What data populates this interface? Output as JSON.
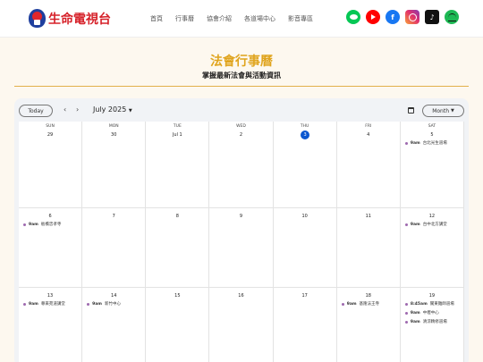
{
  "brand": {
    "name": "生命電視台"
  },
  "nav": [
    "首頁",
    "行事曆",
    "協會介紹",
    "各道場中心",
    "影音專區"
  ],
  "social": [
    "line-icon",
    "youtube-icon",
    "facebook-icon",
    "instagram-icon",
    "tiktok-icon",
    "spotify-icon"
  ],
  "colors": {
    "accent": "#e0a41d",
    "today": "#0b57d0",
    "event_dot": "#9e69af",
    "brand_red": "#d62129"
  },
  "page": {
    "title": "法會行事曆",
    "subtitle": "掌握最新法會與活動資訊"
  },
  "calendar": {
    "today_label": "Today",
    "month_label": "July 2025",
    "view_label": "Month",
    "weekdays": [
      "SUN",
      "MON",
      "TUE",
      "WED",
      "THU",
      "FRI",
      "SAT"
    ],
    "weeks": [
      {
        "days": [
          {
            "num": "29",
            "events": []
          },
          {
            "num": "30",
            "events": []
          },
          {
            "num": "Jul 1",
            "events": []
          },
          {
            "num": "2",
            "events": []
          },
          {
            "num": "3",
            "today": true,
            "events": []
          },
          {
            "num": "4",
            "events": []
          },
          {
            "num": "5",
            "events": [
              {
                "time": "9am",
                "title": "台北光生道場"
              }
            ]
          }
        ]
      },
      {
        "days": [
          {
            "num": "6",
            "events": [
              {
                "time": "9am",
                "title": "板橋忠孝寺"
              }
            ]
          },
          {
            "num": "7",
            "events": []
          },
          {
            "num": "8",
            "events": []
          },
          {
            "num": "9",
            "events": []
          },
          {
            "num": "10",
            "events": []
          },
          {
            "num": "11",
            "events": []
          },
          {
            "num": "12",
            "events": [
              {
                "time": "9am",
                "title": "台中北方講堂"
              }
            ]
          }
        ]
      },
      {
        "days": [
          {
            "num": "13",
            "events": [
              {
                "time": "9am",
                "title": "尊來苑道講堂"
              }
            ]
          },
          {
            "num": "14",
            "events": [
              {
                "time": "9am",
                "title": "新竹中心"
              }
            ]
          },
          {
            "num": "15",
            "events": []
          },
          {
            "num": "16",
            "events": []
          },
          {
            "num": "17",
            "events": []
          },
          {
            "num": "18",
            "events": [
              {
                "time": "9am",
                "title": "基隆法王寺"
              }
            ]
          },
          {
            "num": "19",
            "events": [
              {
                "time": "8:45am",
                "title": "關東雜師道場"
              },
              {
                "time": "9am",
                "title": "中壢中心"
              },
              {
                "time": "9am",
                "title": "清涼精修道場"
              }
            ]
          }
        ]
      }
    ]
  }
}
